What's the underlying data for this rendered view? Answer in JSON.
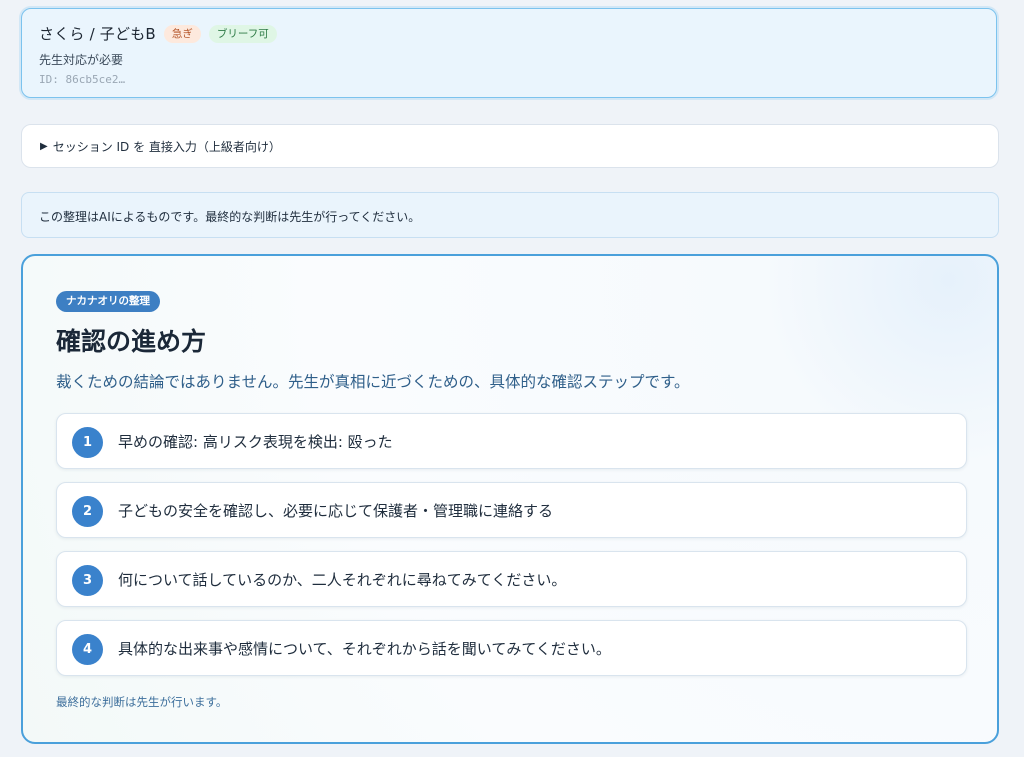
{
  "session_card": {
    "title": "さくら / 子どもB",
    "badge_urgent": "急ぎ",
    "badge_brief": "ブリーフ可",
    "subtitle": "先生対応が必要",
    "id_text": "ID: 86cb5ce2…"
  },
  "direct_input": {
    "arrow": "▶",
    "label": "セッション ID を 直接入力（上級者向け）"
  },
  "notice": {
    "text": "この整理はAIによるものです。最終的な判断は先生が行ってください。"
  },
  "main": {
    "pill": "ナカナオリの整理",
    "title": "確認の進め方",
    "subtitle": "裁くための結論ではありません。先生が真相に近づくための、具体的な確認ステップです。",
    "steps": [
      {
        "num": "1",
        "text": "早めの確認: 高リスク表現を検出: 殴った"
      },
      {
        "num": "2",
        "text": "子どもの安全を確認し、必要に応じて保護者・管理職に連絡する"
      },
      {
        "num": "3",
        "text": "何について話しているのか、二人それぞれに尋ねてみてください。"
      },
      {
        "num": "4",
        "text": "具体的な出来事や感情について、それぞれから話を聞いてみてください。"
      }
    ],
    "footnote": "最終的な判断は先生が行います。"
  },
  "colors": {
    "accent": "#3a82cc",
    "session_border": "#7cc3ee",
    "main_border": "#4aa0db"
  }
}
